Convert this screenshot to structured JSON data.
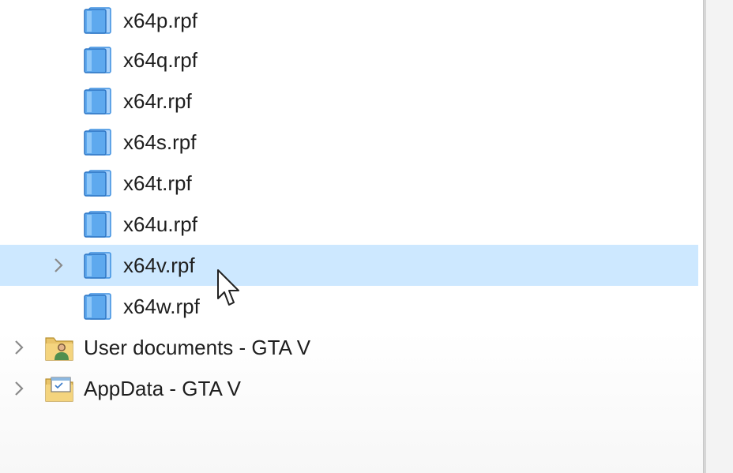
{
  "tree": {
    "files": [
      {
        "label": "x64p.rpf",
        "icon": "archive-icon"
      },
      {
        "label": "x64q.rpf",
        "icon": "archive-icon"
      },
      {
        "label": "x64r.rpf",
        "icon": "archive-icon"
      },
      {
        "label": "x64s.rpf",
        "icon": "archive-icon"
      },
      {
        "label": "x64t.rpf",
        "icon": "archive-icon"
      },
      {
        "label": "x64u.rpf",
        "icon": "archive-icon"
      },
      {
        "label": "x64v.rpf",
        "icon": "archive-icon",
        "selected": true,
        "expandable": true
      },
      {
        "label": "x64w.rpf",
        "icon": "archive-icon"
      }
    ],
    "folders": [
      {
        "label": "User documents - GTA V",
        "icon": "user-folder-icon",
        "expandable": true
      },
      {
        "label": "AppData - GTA V",
        "icon": "app-folder-icon",
        "expandable": true
      }
    ]
  },
  "colors": {
    "selection": "#cde8ff",
    "archive_blue": "#3d8fe0",
    "chevron": "#8a8a8a"
  }
}
